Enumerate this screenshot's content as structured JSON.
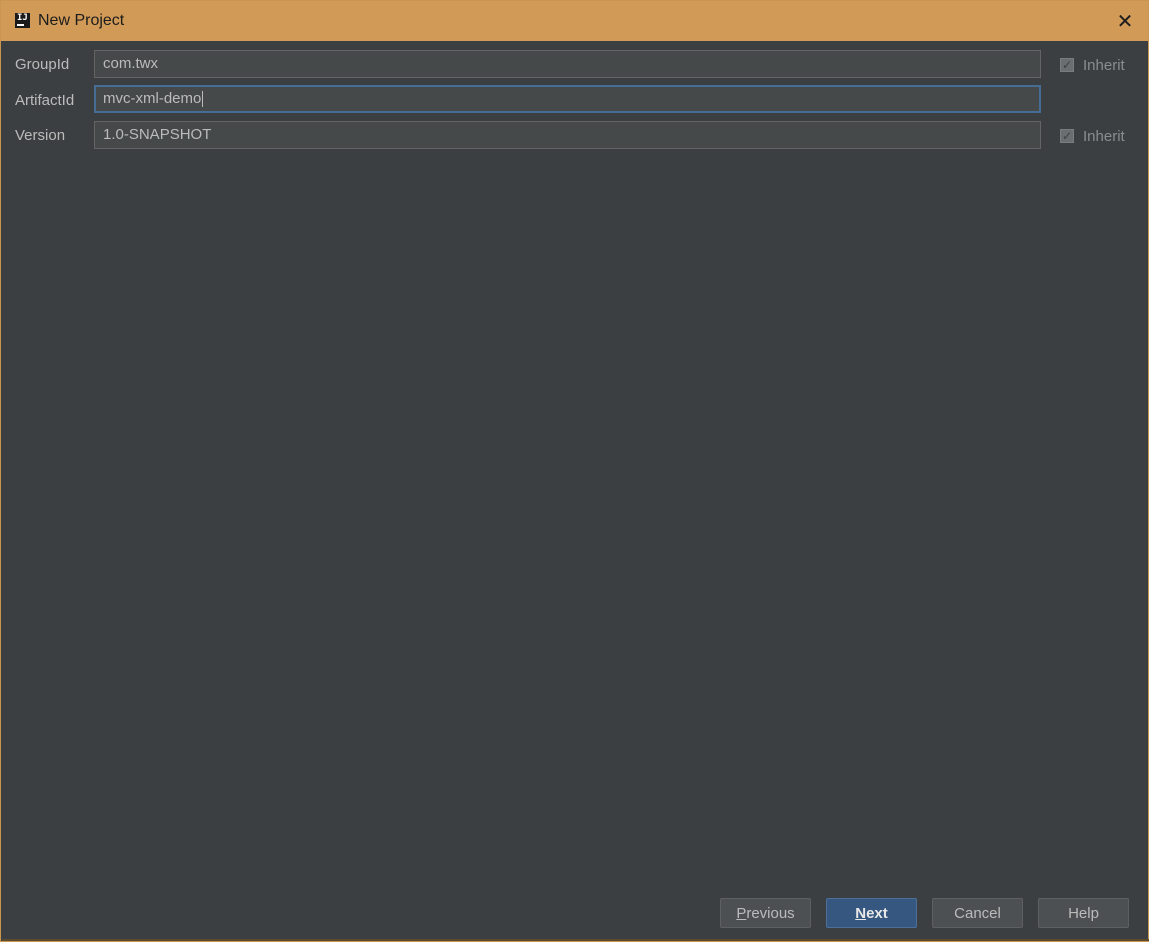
{
  "window": {
    "title": "New Project",
    "app_icon_text": "IJ",
    "close_symbol": "✕"
  },
  "form": {
    "group_id": {
      "label": "GroupId",
      "value": "com.twx",
      "inherit_label": "Inherit",
      "inherit_checked": true
    },
    "artifact_id": {
      "label": "ArtifactId",
      "value": "mvc-xml-demo",
      "focused": true
    },
    "version": {
      "label": "Version",
      "value": "1.0-SNAPSHOT",
      "inherit_label": "Inherit",
      "inherit_checked": true
    }
  },
  "buttons": {
    "previous": {
      "first": "P",
      "rest": "revious"
    },
    "next": {
      "first": "N",
      "rest": "ext"
    },
    "cancel": "Cancel",
    "help": "Help"
  },
  "colors": {
    "titlebar": "#d19a57",
    "background": "#3c3f41",
    "focus_border": "#466d94",
    "primary_button": "#365880"
  },
  "icons": {
    "app": "intellij-icon",
    "close": "close-icon",
    "checkmark": "checkmark-icon"
  }
}
